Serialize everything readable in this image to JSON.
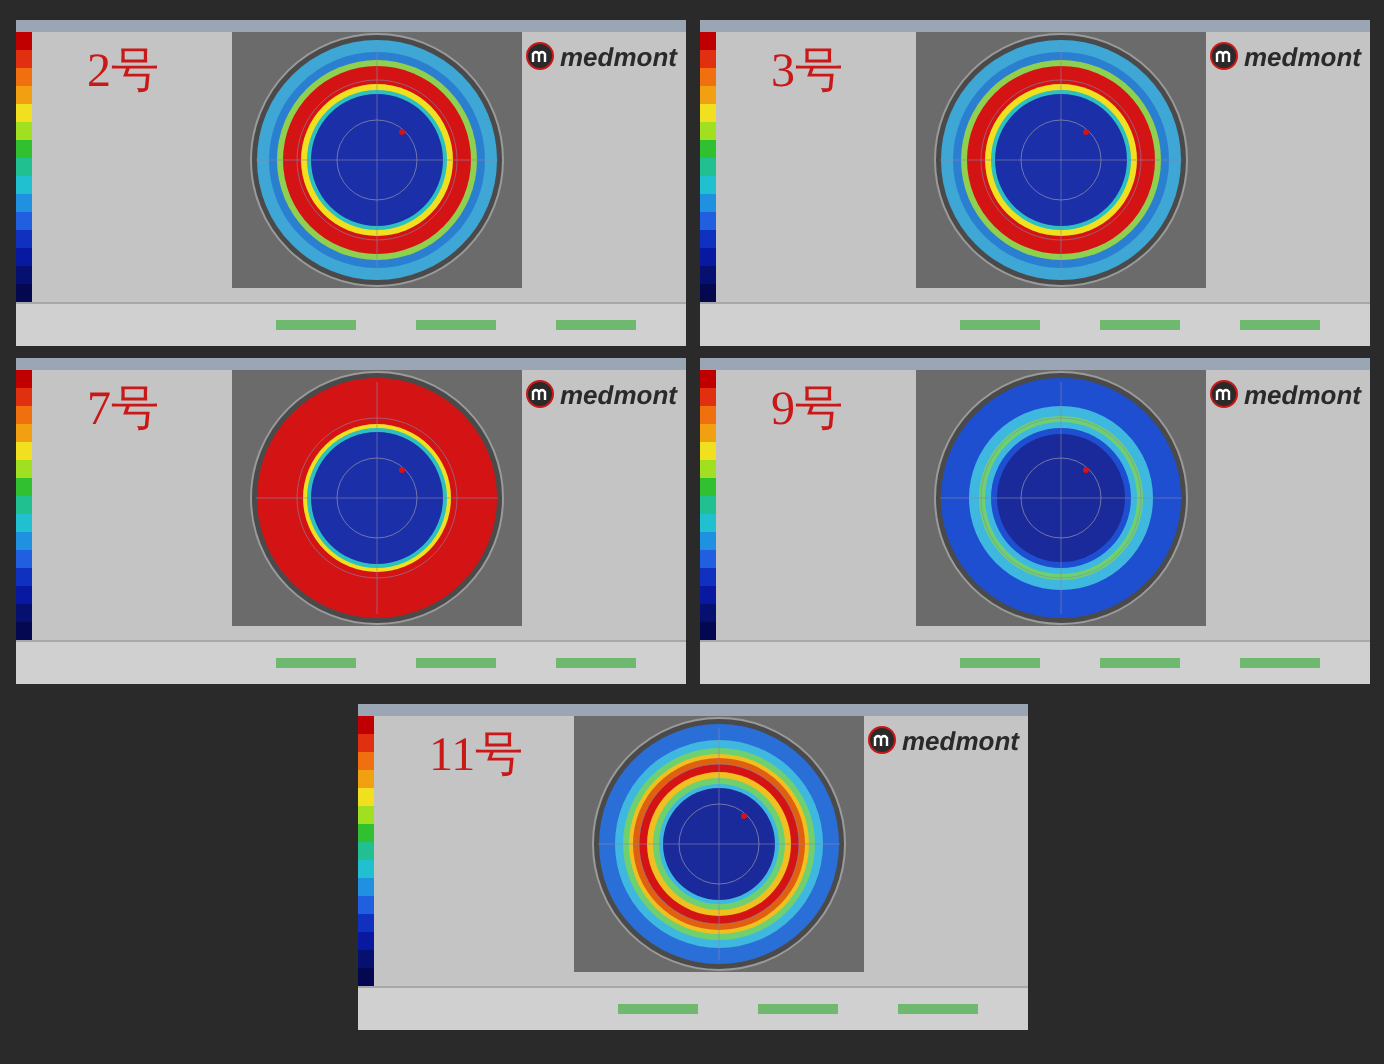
{
  "panels": [
    {
      "label": "2号",
      "logo": "medmont",
      "kind": "red-band"
    },
    {
      "label": "3号",
      "logo": "medmont",
      "kind": "red-band"
    },
    {
      "label": "7号",
      "logo": "medmont",
      "kind": "solid-red"
    },
    {
      "label": "9号",
      "logo": "medmont",
      "kind": "cyan-band"
    },
    {
      "label": "11号",
      "logo": "medmont",
      "kind": "graded"
    }
  ]
}
